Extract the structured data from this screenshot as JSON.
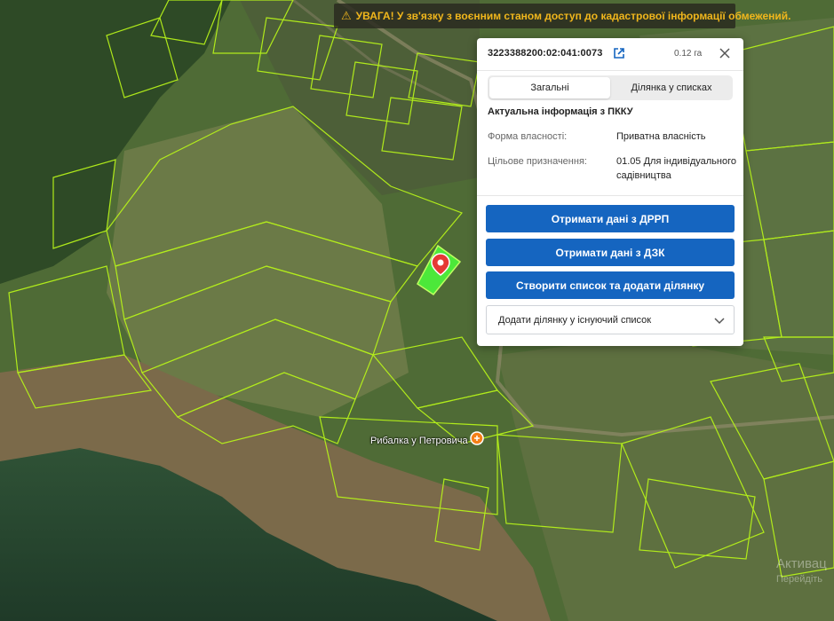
{
  "map": {
    "poi_label": "Рибалка у Петровича",
    "watermark_line1": "Активац",
    "watermark_line2": "Перейдіть"
  },
  "warning": {
    "icon": "warning-triangle-icon",
    "text": "УВАГА! У зв'язку з воєнним станом доступ до кадастрової інформації обмежений.",
    "color": "#f0b61c"
  },
  "panel": {
    "cadastral_number": "3223388200:02:041:0073",
    "area": "0.12 га",
    "tabs": [
      "Загальні",
      "Ділянка у списках"
    ],
    "active_tab": "Загальні",
    "section_title": "Актуальна інформація з ПККУ",
    "rows": [
      {
        "label": "Форма власності:",
        "value": "Приватна власність"
      },
      {
        "label": "Цільове призначення:",
        "value": "01.05 Для індивідуального садівництва"
      }
    ],
    "buttons": [
      "Отримати дані з ДРРП",
      "Отримати дані з ДЗК",
      "Створити список та додати ділянку"
    ],
    "select_label": "Додати ділянку у існуючий список",
    "accent_color": "#1565c0"
  }
}
